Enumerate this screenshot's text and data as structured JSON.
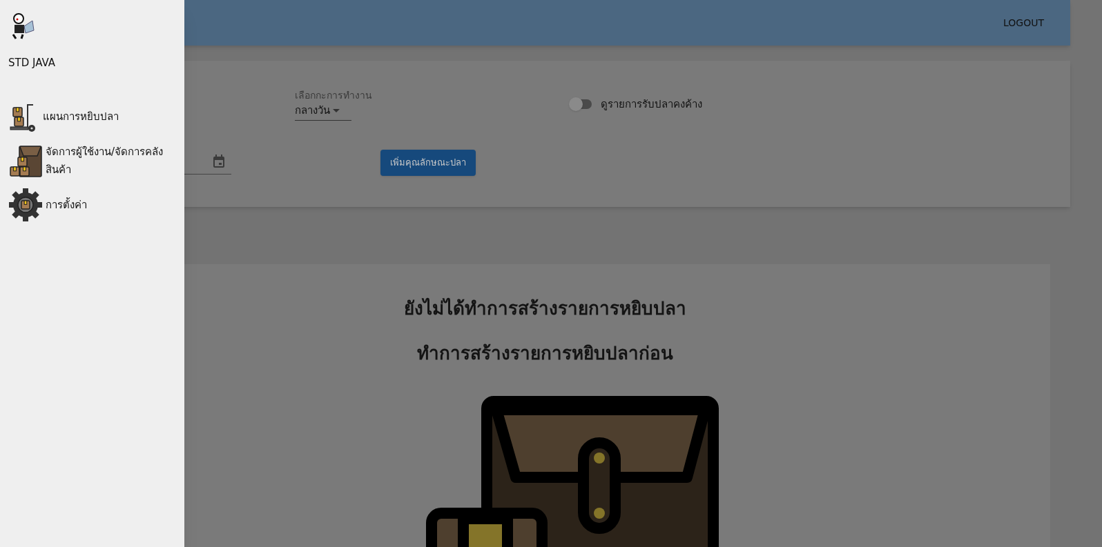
{
  "header": {
    "logout": "LOGOUT"
  },
  "filters": {
    "shift_select": {
      "label": "เลือกกะการทำงาน",
      "value": "กลางวัน"
    },
    "toggle": {
      "label": "ดูรายการรับปลาคงค้าง",
      "on": false
    },
    "add_button": "เพิ่มคุณลักษณะปลา"
  },
  "empty_state": {
    "title": "ยังไม่ได้ทำการสร้างรายการหยิบปลา",
    "subtitle": "ทำการสร้างรายการหยิบปลาก่อน"
  },
  "drawer": {
    "title": "STD JAVA",
    "items": [
      {
        "label": "แผนการหยิบปลา",
        "kind": "trolley"
      },
      {
        "label": "จัดการผู้ใช้งาน/จัดการคลังสินค้า",
        "kind": "warehouse"
      },
      {
        "label": "การตั้งค่า",
        "kind": "settings"
      }
    ]
  }
}
